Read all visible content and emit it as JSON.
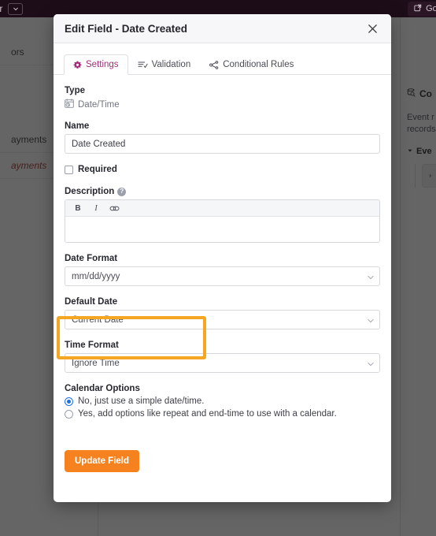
{
  "topbar": {
    "title_fragment": "lar",
    "chevron_icon": "chevron-down-icon",
    "go_to_label": "Go to",
    "go_to_icon": "external-link-icon"
  },
  "background": {
    "sidebar_items": [
      {
        "label": "ors",
        "accent": false
      },
      {
        "label": "ayments",
        "accent": false
      },
      {
        "label": "ayments",
        "accent": true
      }
    ],
    "right_panel": {
      "icon": "database-search-icon",
      "title": "Co",
      "description_line1": "Event r",
      "description_line2": "records",
      "group_caret_icon": "caret-down-icon",
      "group_label": "Eve",
      "sub_item_icon": "caret-right-icon"
    }
  },
  "modal": {
    "title": "Edit Field - Date Created",
    "close_icon": "close-icon",
    "tabs": [
      {
        "label": "Settings",
        "icon": "gear-icon",
        "active": true
      },
      {
        "label": "Validation",
        "icon": "validation-list-icon",
        "active": false
      },
      {
        "label": "Conditional Rules",
        "icon": "branch-icon",
        "active": false
      }
    ],
    "fields": {
      "type_label": "Type",
      "type_value": "Date/Time",
      "type_icon": "calendar-clock-icon",
      "name_label": "Name",
      "name_value": "Date Created",
      "required_label": "Required",
      "required_checked": false,
      "description_label": "Description",
      "description_help_icon": "help-circle-icon",
      "description_value": "",
      "editor_tools": [
        {
          "name": "bold-button",
          "label": "B"
        },
        {
          "name": "italic-button",
          "label": "I"
        },
        {
          "name": "link-button",
          "label": "∞"
        }
      ],
      "date_format_label": "Date Format",
      "date_format_value": "mm/dd/yyyy",
      "default_date_label": "Default Date",
      "default_date_value": "Current Date",
      "time_format_label": "Time Format",
      "time_format_value": "Ignore Time",
      "calendar_options_label": "Calendar Options",
      "calendar_option_no": "No, just use a simple date/time.",
      "calendar_option_yes": "Yes, add options like repeat and end-time to use with a calendar.",
      "calendar_selected": "no"
    },
    "submit_label": "Update Field"
  },
  "annotation": {
    "highlight_target": "default-date-field",
    "highlight_color": "#f5a623"
  }
}
